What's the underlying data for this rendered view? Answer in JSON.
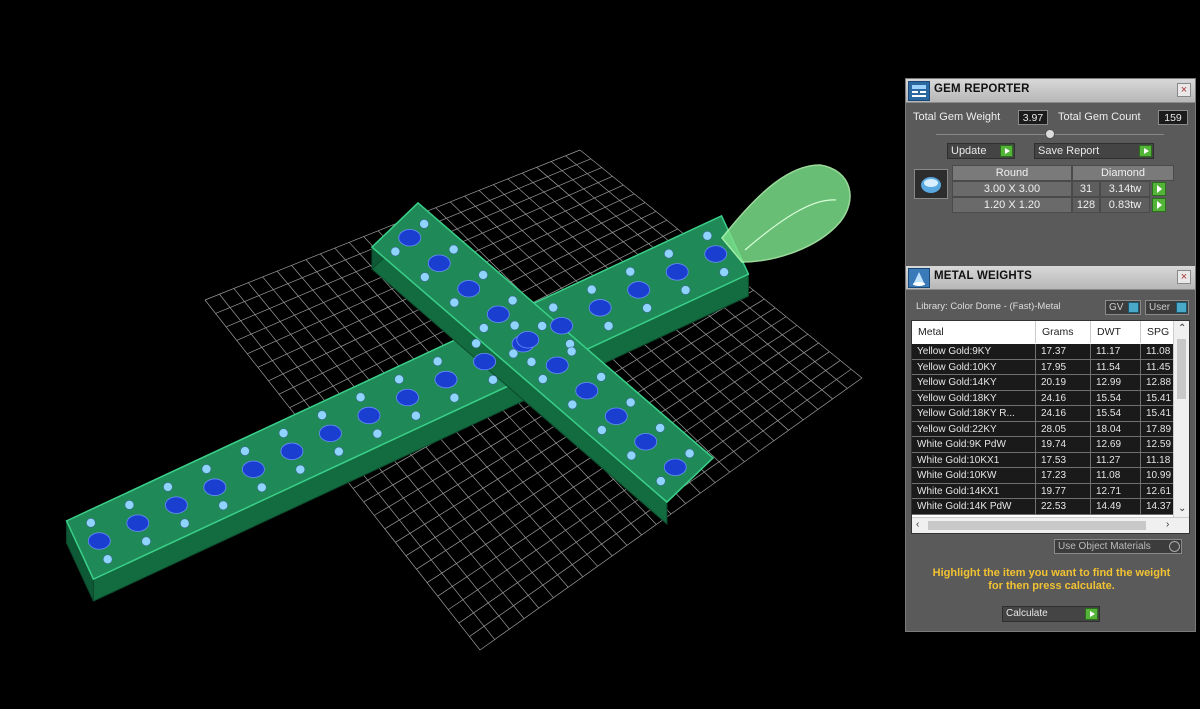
{
  "gem_reporter": {
    "title": "GEM REPORTER",
    "total_weight_label": "Total Gem Weight",
    "total_weight_value": "3.97",
    "total_count_label": "Total Gem Count",
    "total_count_value": "159",
    "update_label": "Update",
    "save_label": "Save Report",
    "table": {
      "shape": "Round",
      "material": "Diamond",
      "rows": [
        {
          "size": "3.00 X 3.00",
          "count": "31",
          "weight": "3.14tw"
        },
        {
          "size": "1.20 X 1.20",
          "count": "128",
          "weight": "0.83tw"
        }
      ]
    }
  },
  "metal_weights": {
    "title": "METAL WEIGHTS",
    "library": "Library: Color Dome - (Fast)-Metal",
    "gv_label": "GV",
    "user_label": "User",
    "columns": [
      "Metal",
      "Grams",
      "DWT",
      "SPG"
    ],
    "rows": [
      [
        "Yellow Gold:9KY",
        "17.37",
        "11.17",
        "11.08"
      ],
      [
        "Yellow Gold:10KY",
        "17.95",
        "11.54",
        "11.45"
      ],
      [
        "Yellow Gold:14KY",
        "20.19",
        "12.99",
        "12.88"
      ],
      [
        "Yellow Gold:18KY",
        "24.16",
        "15.54",
        "15.41"
      ],
      [
        "Yellow Gold:18KY R...",
        "24.16",
        "15.54",
        "15.41"
      ],
      [
        "Yellow Gold:22KY",
        "28.05",
        "18.04",
        "17.89"
      ],
      [
        "White Gold:9K PdW",
        "19.74",
        "12.69",
        "12.59"
      ],
      [
        "White Gold:10KX1",
        "17.53",
        "11.27",
        "11.18"
      ],
      [
        "White Gold:10KW",
        "17.23",
        "11.08",
        "10.99"
      ],
      [
        "White Gold:14KX1",
        "19.77",
        "12.71",
        "12.61"
      ],
      [
        "White Gold:14K PdW",
        "22.53",
        "14.49",
        "14.37"
      ]
    ],
    "use_object_label": "Use Object Materials",
    "hint_line1": "Highlight the item you want to find the weight",
    "hint_line2": "for then press calculate.",
    "calculate_label": "Calculate"
  },
  "colors": {
    "cross_body": "#1f8a57",
    "cross_edge": "#3ad08a",
    "gem_large": "#1a3fd0",
    "gem_small": "#8fd4ff",
    "bail": "#7be08a",
    "grid": "#9a9a9a",
    "hint": "#f1c232",
    "go_button": "#54b43a"
  }
}
